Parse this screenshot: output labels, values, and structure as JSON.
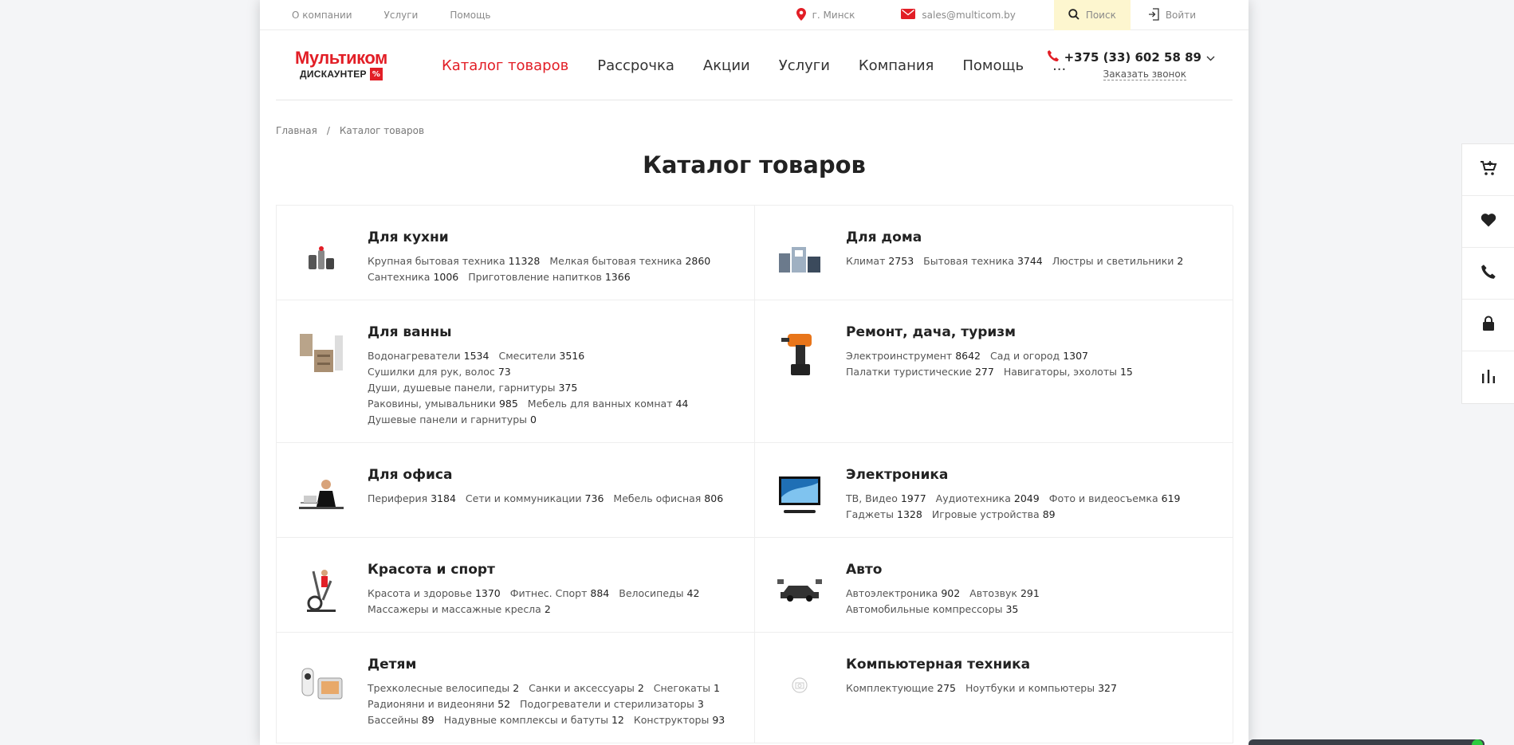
{
  "topbar": {
    "links": [
      "О компании",
      "Услуги",
      "Помощь"
    ],
    "city": "г. Минск",
    "email": "sales@multicom.by",
    "search_label": "Поиск",
    "login_label": "Войти"
  },
  "header": {
    "logo_top": "Мультиком",
    "logo_bottom": "ДИСКАУНТЕР",
    "logo_badge": "%",
    "nav": [
      "Каталог товаров",
      "Рассрочка",
      "Акции",
      "Услуги",
      "Компания",
      "Помощь",
      "..."
    ],
    "phone": "+375 (33) 602 58 89",
    "callback_label": "Заказать звонок"
  },
  "breadcrumb": [
    "Главная",
    "Каталог товаров"
  ],
  "breadcrumb_separator": "/",
  "page_title": "Каталог товаров",
  "catalog": [
    {
      "title": "Для кухни",
      "icon": "kitchen-appliances-icon",
      "subs": [
        {
          "name": "Крупная бытовая техника",
          "count": "11328"
        },
        {
          "name": "Мелкая бытовая техника",
          "count": "2860"
        },
        {
          "name": "Сантехника",
          "count": "1006"
        },
        {
          "name": "Приготовление напитков",
          "count": "1366"
        }
      ]
    },
    {
      "title": "Для дома",
      "icon": "home-appliances-icon",
      "subs": [
        {
          "name": "Климат",
          "count": "2753"
        },
        {
          "name": "Бытовая техника",
          "count": "3744"
        },
        {
          "name": "Люстры и светильники",
          "count": "2"
        }
      ]
    },
    {
      "title": "Для ванны",
      "icon": "bathroom-furniture-icon",
      "subs": [
        {
          "name": "Водонагреватели",
          "count": "1534"
        },
        {
          "name": "Смесители",
          "count": "3516"
        },
        {
          "name": "Сушилки для рук, волос",
          "count": "73"
        },
        {
          "name": "Души, душевые панели, гарнитуры",
          "count": "375"
        },
        {
          "name": "Раковины, умывальники",
          "count": "985"
        },
        {
          "name": "Мебель для ванных комнат",
          "count": "44"
        },
        {
          "name": "Душевые панели и гарнитуры",
          "count": "0"
        }
      ]
    },
    {
      "title": "Ремонт, дача, туризм",
      "icon": "drill-icon",
      "subs": [
        {
          "name": "Электроинструмент",
          "count": "8642"
        },
        {
          "name": "Сад и огород",
          "count": "1307"
        },
        {
          "name": "Палатки туристические",
          "count": "277"
        },
        {
          "name": "Навигаторы, эхолоты",
          "count": "15"
        }
      ]
    },
    {
      "title": "Для офиса",
      "icon": "office-worker-icon",
      "subs": [
        {
          "name": "Периферия",
          "count": "3184"
        },
        {
          "name": "Сети и коммуникации",
          "count": "736"
        },
        {
          "name": "Мебель офисная",
          "count": "806"
        }
      ]
    },
    {
      "title": "Электроника",
      "icon": "tv-icon",
      "subs": [
        {
          "name": "ТВ, Видео",
          "count": "1977"
        },
        {
          "name": "Аудиотехника",
          "count": "2049"
        },
        {
          "name": "Фото и видеосъемка",
          "count": "619"
        },
        {
          "name": "Гаджеты",
          "count": "1328"
        },
        {
          "name": "Игровые устройства",
          "count": "89"
        }
      ]
    },
    {
      "title": "Красота и спорт",
      "icon": "elliptical-trainer-icon",
      "subs": [
        {
          "name": "Красота и здоровье",
          "count": "1370"
        },
        {
          "name": "Фитнес. Спорт",
          "count": "884"
        },
        {
          "name": "Велосипеды",
          "count": "42"
        },
        {
          "name": "Массажеры и массажные кресла",
          "count": "2"
        }
      ]
    },
    {
      "title": "Авто",
      "icon": "car-parts-icon",
      "subs": [
        {
          "name": "Автоэлектроника",
          "count": "902"
        },
        {
          "name": "Автозвук",
          "count": "291"
        },
        {
          "name": "Автомобильные компрессоры",
          "count": "35"
        }
      ]
    },
    {
      "title": "Детям",
      "icon": "baby-monitor-icon",
      "subs": [
        {
          "name": "Трехколесные велосипеды",
          "count": "2"
        },
        {
          "name": "Санки и аксессуары",
          "count": "2"
        },
        {
          "name": "Снегокаты",
          "count": "1"
        },
        {
          "name": "Радионяни и видеоняни",
          "count": "52"
        },
        {
          "name": "Подогреватели и стерилизаторы",
          "count": "3"
        },
        {
          "name": "Бассейны",
          "count": "89"
        },
        {
          "name": "Надувные комплексы и батуты",
          "count": "12"
        },
        {
          "name": "Конструкторы",
          "count": "93"
        }
      ]
    },
    {
      "title": "Компьютерная техника",
      "icon": "placeholder-image-icon",
      "subs": [
        {
          "name": "Комплектующие",
          "count": "275"
        },
        {
          "name": "Ноутбуки и компьютеры",
          "count": "327"
        }
      ]
    }
  ],
  "side_panel": [
    "cart-icon",
    "heart-icon",
    "phone-icon",
    "lock-icon",
    "compare-chart-icon"
  ],
  "colors": {
    "accent": "#e21e26",
    "search_bg": "#fdf6cf",
    "text": "#222222",
    "muted": "#8a8a8a"
  }
}
